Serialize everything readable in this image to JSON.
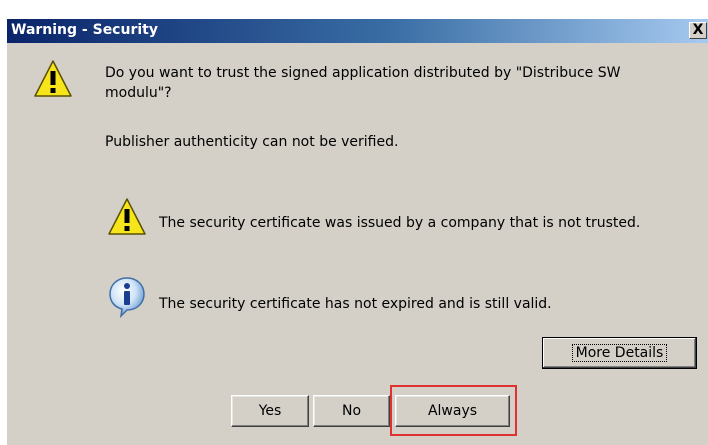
{
  "window": {
    "title": "Warning - Security",
    "close_glyph": "X"
  },
  "message": {
    "question_line1": "Do you want to trust the signed application distributed by \"Distribuce SW",
    "question_line2": "modulu\"?",
    "publisher_note": "Publisher authenticity can not be verified."
  },
  "details": [
    {
      "icon": "warning-icon",
      "text": "The security certificate was issued by a company that is not trusted."
    },
    {
      "icon": "info-icon",
      "text": "The security certificate has not expired and is still valid."
    }
  ],
  "buttons": {
    "more_details": "More Details",
    "yes": "Yes",
    "no": "No",
    "always": "Always"
  },
  "colors": {
    "dialog_bg": "#d4d0c8",
    "title_gradient_start": "#0a246a",
    "title_gradient_end": "#a6caf0",
    "highlight_border": "#e03030"
  }
}
